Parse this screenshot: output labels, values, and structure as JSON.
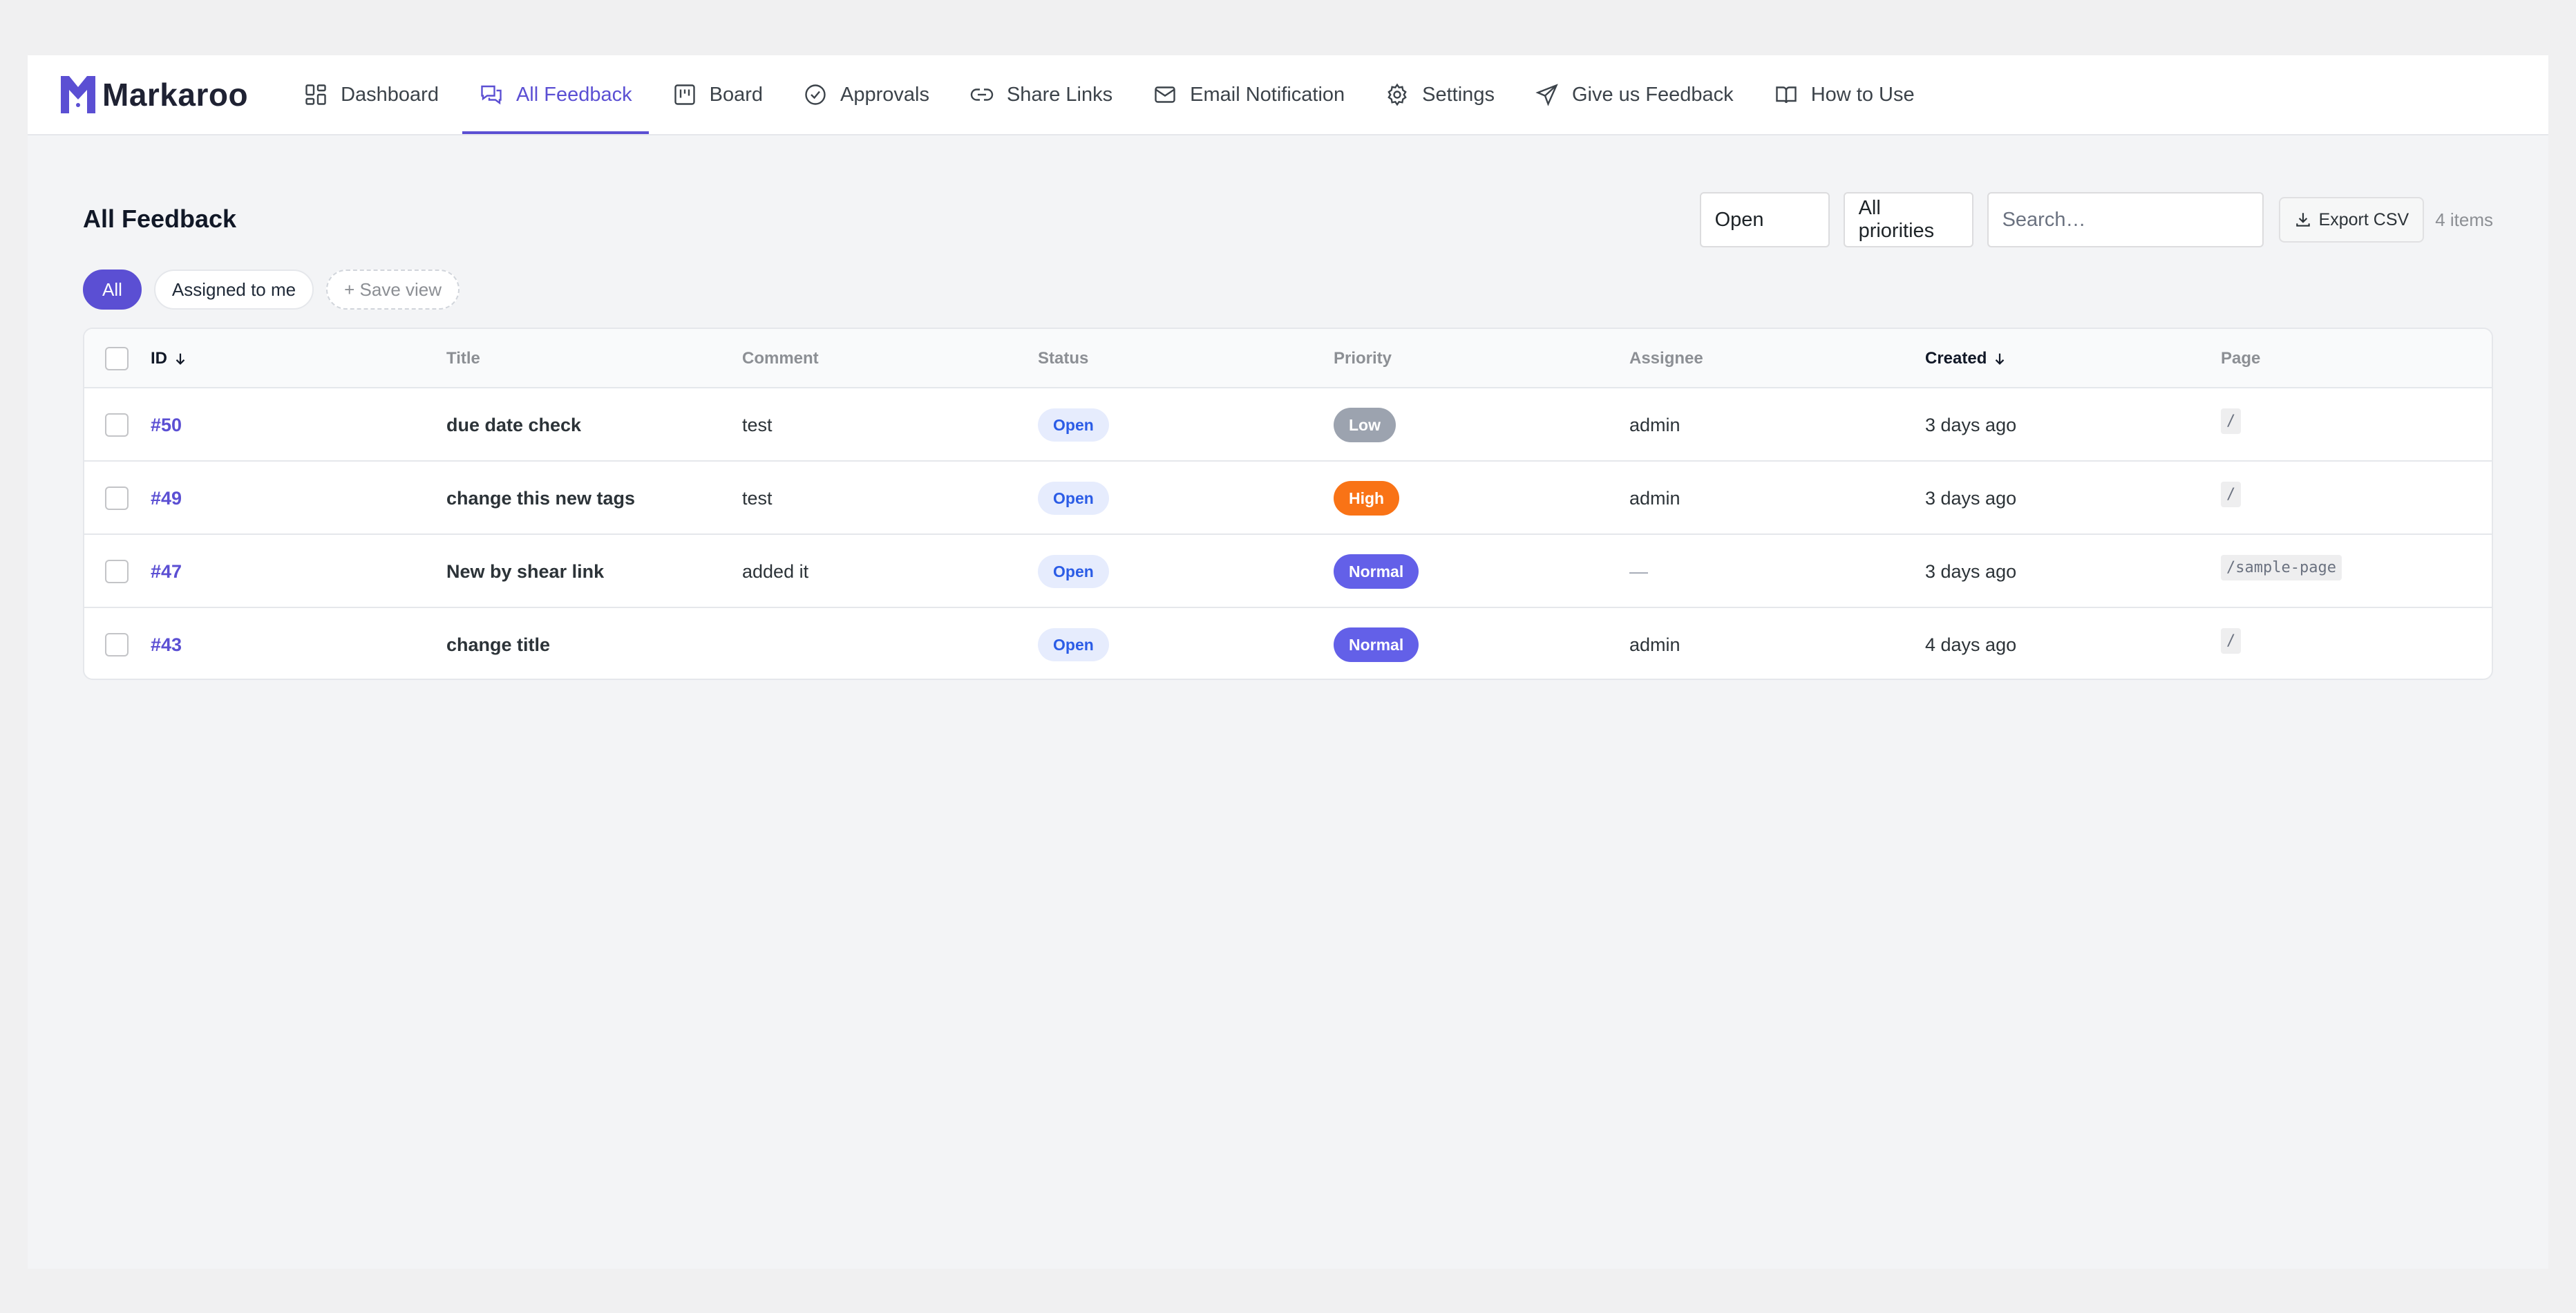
{
  "app": {
    "name": "Markaroo",
    "brand_color": "#5b4fd3"
  },
  "nav": {
    "items": [
      {
        "label": "Dashboard",
        "icon": "dashboard-grid-icon"
      },
      {
        "label": "All Feedback",
        "icon": "chat-bubbles-icon",
        "active": true
      },
      {
        "label": "Board",
        "icon": "board-columns-icon"
      },
      {
        "label": "Approvals",
        "icon": "check-circle-icon"
      },
      {
        "label": "Share Links",
        "icon": "link-icon"
      },
      {
        "label": "Email Notification",
        "icon": "envelope-icon"
      },
      {
        "label": "Settings",
        "icon": "gear-icon"
      },
      {
        "label": "Give us Feedback",
        "icon": "paper-plane-icon"
      },
      {
        "label": "How to Use",
        "icon": "open-book-icon"
      }
    ]
  },
  "header": {
    "title": "All Feedback",
    "status_filter": "Open",
    "priority_filter": "All priorities",
    "search_placeholder": "Search…",
    "export_label": "Export CSV",
    "count_label": "4 items"
  },
  "views": {
    "all": "All",
    "assigned": "Assigned to me",
    "save": "+ Save view"
  },
  "table": {
    "columns": {
      "id": "ID",
      "title": "Title",
      "comment": "Comment",
      "status": "Status",
      "priority": "Priority",
      "assignee": "Assignee",
      "created": "Created",
      "page": "Page"
    },
    "rows": [
      {
        "id": "#50",
        "title": "due date check",
        "comment": "test",
        "status": "Open",
        "priority": "Low",
        "priority_color": "#9ca3af",
        "assignee": "admin",
        "created": "3 days ago",
        "page": "/"
      },
      {
        "id": "#49",
        "title": "change this new tags",
        "comment": "test",
        "status": "Open",
        "priority": "High",
        "priority_color": "#f97316",
        "assignee": "admin",
        "created": "3 days ago",
        "page": "/"
      },
      {
        "id": "#47",
        "title": "New by shear link",
        "comment": "added it",
        "status": "Open",
        "priority": "Normal",
        "priority_color": "#6360e8",
        "assignee": "—",
        "created": "3 days ago",
        "page": "/sample-page"
      },
      {
        "id": "#43",
        "title": "change title",
        "comment": "",
        "status": "Open",
        "priority": "Normal",
        "priority_color": "#6360e8",
        "assignee": "admin",
        "created": "4 days ago",
        "page": "/"
      }
    ]
  }
}
